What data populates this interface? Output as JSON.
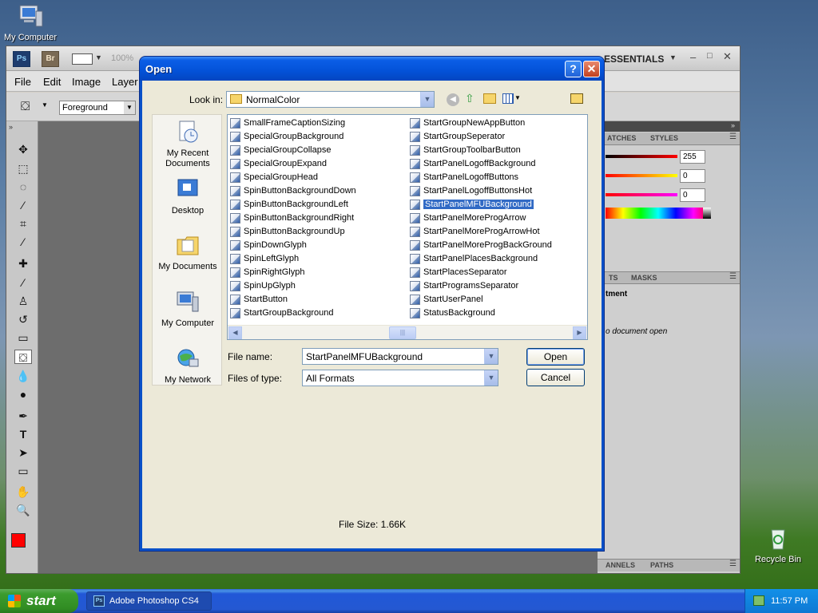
{
  "desktop": {
    "icons": [
      {
        "label": "My Computer"
      },
      {
        "label": "Recycle Bin"
      }
    ]
  },
  "photoshop": {
    "logo": "Ps",
    "bridge": "Br",
    "zoom": "100%",
    "workspace": "ESSENTIALS",
    "menu": [
      "File",
      "Edit",
      "Image",
      "Layer"
    ],
    "fill_source": "Foreground",
    "panels": {
      "tabs_top": [
        "ATCHES",
        "STYLES"
      ],
      "rgb_values": [
        "255",
        "0",
        "0"
      ],
      "tabs_mid": [
        "TS",
        "MASKS"
      ],
      "adjustment_label": "tment",
      "no_doc": "o document open",
      "tabs_bottom": [
        "ANNELS",
        "PATHS"
      ]
    }
  },
  "dialog": {
    "title": "Open",
    "look_in_label": "Look in:",
    "look_in_value": "NormalColor",
    "places": [
      "My Recent Documents",
      "Desktop",
      "My Documents",
      "My Computer",
      "My Network"
    ],
    "files_col1": [
      "SmallFrameCaptionSizing",
      "SpecialGroupBackground",
      "SpecialGroupCollapse",
      "SpecialGroupExpand",
      "SpecialGroupHead",
      "SpinButtonBackgroundDown",
      "SpinButtonBackgroundLeft",
      "SpinButtonBackgroundRight",
      "SpinButtonBackgroundUp",
      "SpinDownGlyph",
      "SpinLeftGlyph",
      "SpinRightGlyph",
      "SpinUpGlyph",
      "StartButton",
      "StartGroupBackground"
    ],
    "files_col2": [
      "StartGroupNewAppButton",
      "StartGroupSeperator",
      "StartGroupToolbarButton",
      "StartPanelLogoffBackground",
      "StartPanelLogoffButtons",
      "StartPanelLogoffButtonsHot",
      "StartPanelMFUBackground",
      "StartPanelMoreProgArrow",
      "StartPanelMoreProgArrowHot",
      "StartPanelMoreProgBackGround",
      "StartPanelPlacesBackground",
      "StartPlacesSeparator",
      "StartProgramsSeparator",
      "StartUserPanel",
      "StatusBackground"
    ],
    "selected_file": "StartPanelMFUBackground",
    "file_name_label": "File name:",
    "file_name_value": "StartPanelMFUBackground",
    "file_type_label": "Files of type:",
    "file_type_value": "All Formats",
    "open_button": "Open",
    "cancel_button": "Cancel",
    "file_size": "File Size: 1.66K"
  },
  "taskbar": {
    "start": "start",
    "task": "Adobe Photoshop CS4",
    "clock": "11:57 PM"
  },
  "colors": {
    "xp_blue": "#0a50c8",
    "selection": "#316ac5",
    "foreground_swatch": "#ff0000"
  }
}
